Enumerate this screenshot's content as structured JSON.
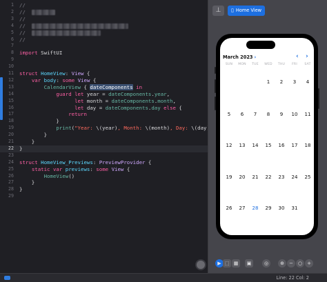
{
  "editor": {
    "lines": [
      {
        "n": "1",
        "parts": [
          {
            "t": "//",
            "c": "cm"
          }
        ]
      },
      {
        "n": "2",
        "parts": [
          {
            "t": "//  ",
            "c": "cm"
          },
          {
            "blur": 34
          }
        ]
      },
      {
        "n": "3",
        "parts": [
          {
            "t": "//",
            "c": "cm"
          }
        ]
      },
      {
        "n": "4",
        "parts": [
          {
            "t": "//  ",
            "c": "cm"
          },
          {
            "blur": 140
          }
        ]
      },
      {
        "n": "5",
        "parts": [
          {
            "t": "//  ",
            "c": "cm"
          },
          {
            "blur": 100
          }
        ]
      },
      {
        "n": "6",
        "parts": [
          {
            "t": "//",
            "c": "cm"
          }
        ]
      },
      {
        "n": "7",
        "parts": []
      },
      {
        "n": "8",
        "parts": [
          {
            "t": "import",
            "c": "kw"
          },
          {
            "t": " SwiftUI"
          }
        ]
      },
      {
        "n": "9",
        "parts": []
      },
      {
        "n": "10",
        "parts": []
      },
      {
        "n": "11",
        "parts": [
          {
            "t": "struct",
            "c": "kw"
          },
          {
            "t": " "
          },
          {
            "t": "HomeView",
            "c": "ty"
          },
          {
            "t": ": "
          },
          {
            "t": "View",
            "c": "tyd"
          },
          {
            "t": " {"
          }
        ]
      },
      {
        "n": "12",
        "parts": [
          {
            "t": "    "
          },
          {
            "t": "var",
            "c": "kw"
          },
          {
            "t": " "
          },
          {
            "t": "body",
            "c": "ty"
          },
          {
            "t": ": "
          },
          {
            "t": "some",
            "c": "kw"
          },
          {
            "t": " "
          },
          {
            "t": "View",
            "c": "tyd"
          },
          {
            "t": " {"
          }
        ]
      },
      {
        "n": "13",
        "parts": [
          {
            "t": "        "
          },
          {
            "t": "CalendarView",
            "c": "fn"
          },
          {
            "t": " { "
          },
          {
            "t": "dateComponents",
            "c": "sel"
          },
          {
            "t": " "
          },
          {
            "t": "in",
            "c": "kw"
          }
        ]
      },
      {
        "n": "14",
        "parts": [
          {
            "t": "            "
          },
          {
            "t": "guard",
            "c": "kw"
          },
          {
            "t": " "
          },
          {
            "t": "let",
            "c": "kw"
          },
          {
            "t": " year = "
          },
          {
            "t": "dateComponents",
            "c": "fn"
          },
          {
            "t": "."
          },
          {
            "t": "year",
            "c": "fn"
          },
          {
            "t": ","
          }
        ]
      },
      {
        "n": "15",
        "parts": [
          {
            "t": "                  "
          },
          {
            "t": "let",
            "c": "kw"
          },
          {
            "t": " month = "
          },
          {
            "t": "dateComponents",
            "c": "fn"
          },
          {
            "t": "."
          },
          {
            "t": "month",
            "c": "fn"
          },
          {
            "t": ","
          }
        ]
      },
      {
        "n": "16",
        "parts": [
          {
            "t": "                  "
          },
          {
            "t": "let",
            "c": "kw"
          },
          {
            "t": " day = "
          },
          {
            "t": "dateComponents",
            "c": "fn"
          },
          {
            "t": "."
          },
          {
            "t": "day",
            "c": "fn"
          },
          {
            "t": " "
          },
          {
            "t": "else",
            "c": "kw"
          },
          {
            "t": " {"
          }
        ]
      },
      {
        "n": "17",
        "parts": [
          {
            "t": "                "
          },
          {
            "t": "return",
            "c": "kw"
          }
        ]
      },
      {
        "n": "18",
        "parts": [
          {
            "t": "            }"
          }
        ]
      },
      {
        "n": "19",
        "parts": [
          {
            "t": "            "
          },
          {
            "t": "print",
            "c": "fn"
          },
          {
            "t": "("
          },
          {
            "t": "\"Year: ",
            "c": "str"
          },
          {
            "t": "\\(year)"
          },
          {
            "t": ", Month: ",
            "c": "str"
          },
          {
            "t": "\\(month)"
          },
          {
            "t": ", Day: ",
            "c": "str"
          },
          {
            "t": "\\(day)"
          },
          {
            "t": "\"",
            "c": "str"
          },
          {
            "t": ")"
          }
        ]
      },
      {
        "n": "20",
        "parts": [
          {
            "t": "        }"
          }
        ]
      },
      {
        "n": "21",
        "parts": [
          {
            "t": "    }"
          }
        ]
      },
      {
        "n": "22",
        "parts": [
          {
            "t": "}"
          }
        ],
        "current": true
      },
      {
        "n": "23",
        "parts": []
      },
      {
        "n": "24",
        "parts": [
          {
            "t": "struct",
            "c": "kw"
          },
          {
            "t": " "
          },
          {
            "t": "HomeView_Previews",
            "c": "ty"
          },
          {
            "t": ": "
          },
          {
            "t": "PreviewProvider",
            "c": "tyd"
          },
          {
            "t": " {"
          }
        ]
      },
      {
        "n": "25",
        "parts": [
          {
            "t": "    "
          },
          {
            "t": "static",
            "c": "kw"
          },
          {
            "t": " "
          },
          {
            "t": "var",
            "c": "kw"
          },
          {
            "t": " "
          },
          {
            "t": "previews",
            "c": "ty"
          },
          {
            "t": ": "
          },
          {
            "t": "some",
            "c": "kw"
          },
          {
            "t": " "
          },
          {
            "t": "View",
            "c": "tyd"
          },
          {
            "t": " {"
          }
        ]
      },
      {
        "n": "26",
        "parts": [
          {
            "t": "        "
          },
          {
            "t": "HomeView",
            "c": "fn"
          },
          {
            "t": "()"
          }
        ]
      },
      {
        "n": "27",
        "parts": [
          {
            "t": "    }"
          }
        ]
      },
      {
        "n": "28",
        "parts": [
          {
            "t": "}"
          }
        ]
      },
      {
        "n": "29",
        "parts": []
      }
    ]
  },
  "canvas": {
    "pin_icon": "pin-icon",
    "preview_chip": {
      "label": "Home View",
      "icon": "phone-icon"
    }
  },
  "calendar": {
    "month_title": "March 2023",
    "chevron": "›",
    "prev": "‹",
    "next": "›",
    "weekdays": [
      "SUN",
      "MON",
      "TUE",
      "WED",
      "THU",
      "FRI",
      "SAT"
    ],
    "weeks": [
      [
        "",
        "",
        "",
        "1",
        "2",
        "3",
        "4"
      ],
      [
        "5",
        "6",
        "7",
        "8",
        "9",
        "10",
        "11"
      ],
      [
        "12",
        "13",
        "14",
        "15",
        "16",
        "17",
        "18"
      ],
      [
        "19",
        "20",
        "21",
        "22",
        "23",
        "24",
        "25"
      ],
      [
        "26",
        "27",
        "28",
        "29",
        "30",
        "31",
        ""
      ]
    ],
    "today": "28",
    "accent": "#1d6fe0"
  },
  "canvas_toolbar": {
    "buttons": [
      {
        "name": "live-preview-button",
        "glyph": "▶",
        "active": true
      },
      {
        "name": "selectable-button",
        "glyph": "⬚",
        "active": false
      },
      {
        "name": "variants-button",
        "glyph": "▦",
        "active": false
      },
      {
        "name": "device-settings-button",
        "glyph": "▣",
        "active": false
      },
      {
        "name": "device-button",
        "glyph": "◎",
        "active": false
      },
      {
        "name": "zoom-fit-button",
        "glyph": "⊕",
        "active": false
      },
      {
        "name": "zoom-out-button",
        "glyph": "−",
        "active": false
      },
      {
        "name": "zoom-100-button",
        "glyph": "○",
        "active": false
      },
      {
        "name": "zoom-in-button",
        "glyph": "+",
        "active": false
      }
    ]
  },
  "statusbar": {
    "position": "Line: 22  Col: 2"
  }
}
